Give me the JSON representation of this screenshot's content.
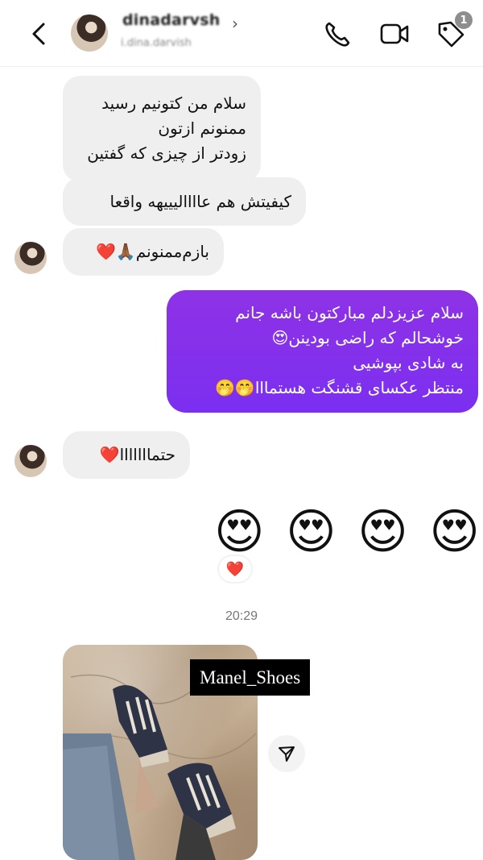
{
  "header": {
    "contact_name": "dinadarvsh",
    "contact_subtitle": "i.dina.darvish",
    "badge_count": "1",
    "icons": [
      "back-arrow-icon",
      "phone-icon",
      "video-camera-icon",
      "tag-icon"
    ]
  },
  "messages": [
    {
      "direction": "incoming",
      "lines": [
        "سلام من کتونیم رسید",
        "ممنونم ازتون",
        "زودتر از چیزی که گفتین"
      ]
    },
    {
      "direction": "incoming",
      "lines": [
        "کیفیتش هم عاااالیییهه واقعا"
      ]
    },
    {
      "direction": "incoming",
      "lines": [
        "بازم‌ممنونم🙏🏾❤️"
      ]
    },
    {
      "direction": "outgoing",
      "lines": [
        "سلام عزیزدلم مبارکتون باشه جانم",
        "خوشحالم که راضی بودینن😍",
        "به شادی بپوشیی",
        "منتظر عکسای قشنگت هستمااا🤭🤭"
      ]
    },
    {
      "direction": "incoming",
      "lines": [
        "حتمااااااا❤️"
      ]
    }
  ],
  "emoji_message": [
    "😍",
    "😍",
    "😍",
    "😍"
  ],
  "reaction": "❤️",
  "timestamp": "20:29",
  "photo": {
    "caption": "Manel_Shoes",
    "share_icon": "send-icon"
  }
}
